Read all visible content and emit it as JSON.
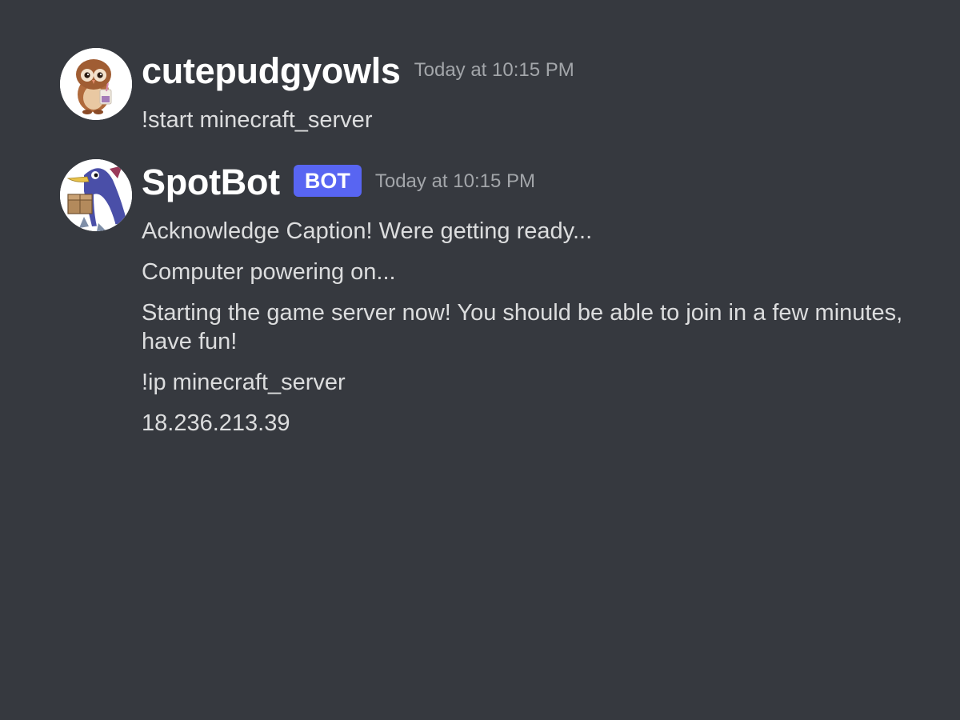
{
  "messages": [
    {
      "author": "cutepudgyowls",
      "timestamp": "Today at 10:15 PM",
      "avatar_icon": "owl-avatar-icon",
      "lines": [
        "!start minecraft_server"
      ]
    },
    {
      "author": "SpotBot",
      "badge": "BOT",
      "timestamp": "Today at 10:15 PM",
      "avatar_icon": "penguin-bird-with-box-avatar-icon",
      "lines": [
        "Acknowledge Caption! Were getting ready...",
        "Computer powering on...",
        "Starting the game server now! You should be able to join in a few minutes, have fun!",
        "!ip minecraft_server",
        "18.236.213.39"
      ]
    }
  ],
  "colors": {
    "background": "#36393f",
    "username": "#ffffff",
    "message_text": "#dcddde",
    "timestamp": "#a3a6aa",
    "bot_badge": "#5865f2"
  }
}
